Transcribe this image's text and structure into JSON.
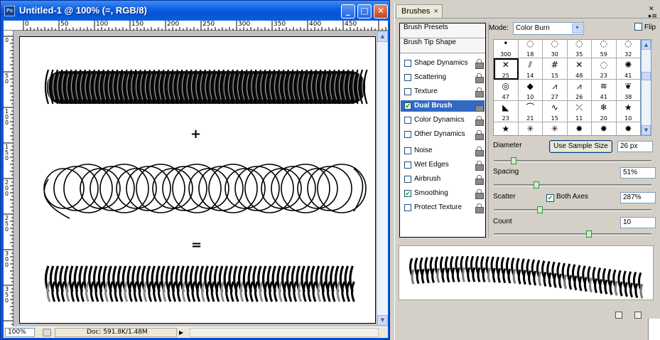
{
  "document": {
    "title": "Untitled-1 @ 100% (=, RGB/8)",
    "ps_logo": "Ps",
    "window_buttons": [
      "_",
      "□",
      "✕"
    ],
    "ruler_top": [
      "0",
      "50",
      "100",
      "150",
      "200",
      "250",
      "300",
      "350",
      "400",
      "450"
    ],
    "ruler_left": [
      "0",
      "5\n0",
      "1\n0\n0",
      "1\n5\n0",
      "2\n0\n0",
      "2\n5\n0",
      "3\n0\n0",
      "3\n5\n0"
    ],
    "canvas_symbols": {
      "plus": "+",
      "equals": "="
    },
    "status": {
      "zoom": "100%",
      "doc_info": "Doc: 591.8K/1.48M"
    }
  },
  "panel": {
    "tab_label": "Brushes",
    "tab_close": "×",
    "sidebar": {
      "presets": "Brush Presets",
      "tip_shape": "Brush Tip Shape",
      "items": [
        {
          "label": "Shape Dynamics",
          "checked": false
        },
        {
          "label": "Scattering",
          "checked": false
        },
        {
          "label": "Texture",
          "checked": false
        },
        {
          "label": "Dual Brush",
          "checked": true,
          "selected": true
        },
        {
          "label": "Color Dynamics",
          "checked": false
        },
        {
          "label": "Other Dynamics",
          "checked": false
        },
        {
          "label": "Noise",
          "checked": false
        },
        {
          "label": "Wet Edges",
          "checked": false
        },
        {
          "label": "Airbrush",
          "checked": false
        },
        {
          "label": "Smoothing",
          "checked": true
        },
        {
          "label": "Protect Texture",
          "checked": false
        }
      ]
    },
    "mode_label": "Mode:",
    "mode_value": "Color Burn",
    "flip_label": "Flip",
    "brushes": [
      {
        "size": "300",
        "icon": "dot"
      },
      {
        "size": "18",
        "icon": "ring"
      },
      {
        "size": "30",
        "icon": "ring"
      },
      {
        "size": "35",
        "icon": "ring"
      },
      {
        "size": "59",
        "icon": "ring"
      },
      {
        "size": "32",
        "icon": "ring"
      },
      {
        "size": "25",
        "icon": "x"
      },
      {
        "size": "14",
        "icon": "hatch"
      },
      {
        "size": "15",
        "icon": "grid"
      },
      {
        "size": "48",
        "icon": "x"
      },
      {
        "size": "23",
        "icon": "ring"
      },
      {
        "size": "41",
        "icon": "spiral"
      },
      {
        "size": "47",
        "icon": "dotring"
      },
      {
        "size": "10",
        "icon": "diamond"
      },
      {
        "size": "27",
        "icon": "zigzag"
      },
      {
        "size": "26",
        "icon": "zigzag"
      },
      {
        "size": "41",
        "icon": "stroke"
      },
      {
        "size": "38",
        "icon": "leaf"
      },
      {
        "size": "23",
        "icon": "wedge"
      },
      {
        "size": "21",
        "icon": "curve"
      },
      {
        "size": "15",
        "icon": "squiggle"
      },
      {
        "size": "11",
        "icon": "dash"
      },
      {
        "size": "20",
        "icon": "snowflake"
      },
      {
        "size": "10",
        "icon": "star"
      },
      {
        "size": "",
        "icon": "star"
      },
      {
        "size": "",
        "icon": "spark"
      },
      {
        "size": "",
        "icon": "spark"
      },
      {
        "size": "",
        "icon": "splat"
      },
      {
        "size": "",
        "icon": "splat"
      },
      {
        "size": "",
        "icon": "splat"
      }
    ],
    "diameter_label": "Diameter",
    "sample_button": "Use Sample Size",
    "diameter_value": "26 px",
    "spacing_label": "Spacing",
    "spacing_value": "51%",
    "spacing_fraction": 0.51,
    "scatter_label": "Scatter",
    "both_axes_label": "Both Axes",
    "both_axes_checked": true,
    "scatter_value": "287%",
    "count_label": "Count",
    "count_value": "10"
  }
}
